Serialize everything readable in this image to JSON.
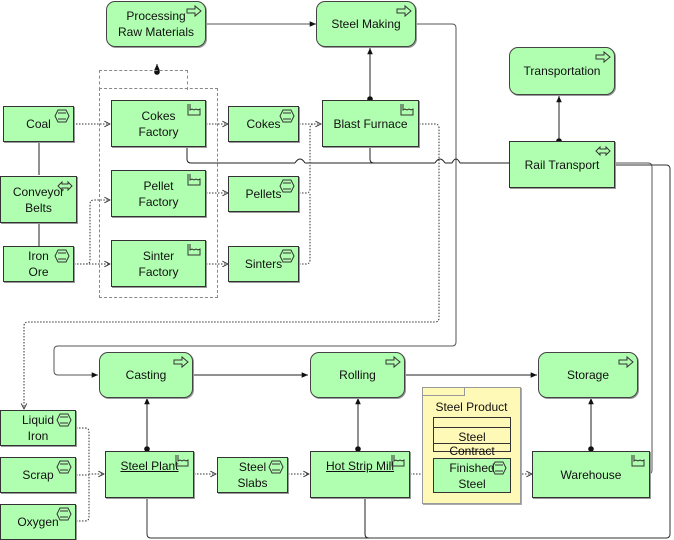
{
  "diagram": {
    "colors": {
      "element_fill": "#b0ffb0",
      "package_fill": "#fff9b8",
      "border": "#333333"
    },
    "functions": {
      "processing_raw_materials": {
        "label": "Processing\nRaw Materials",
        "icon": "function-arrow-icon"
      },
      "steel_making": {
        "label": "Steel Making",
        "icon": "function-arrow-icon"
      },
      "transportation": {
        "label": "Transportation",
        "icon": "function-arrow-icon"
      },
      "casting": {
        "label": "Casting",
        "icon": "function-arrow-icon"
      },
      "rolling": {
        "label": "Rolling",
        "icon": "function-arrow-icon"
      },
      "storage": {
        "label": "Storage",
        "icon": "function-arrow-icon"
      }
    },
    "facilities": {
      "cokes_factory": {
        "label": "Cokes\nFactory",
        "icon": "factory-icon"
      },
      "pellet_factory": {
        "label": "Pellet\nFactory",
        "icon": "factory-icon"
      },
      "sinter_factory": {
        "label": "Sinter\nFactory",
        "icon": "factory-icon"
      },
      "blast_furnace": {
        "label": "Blast Furnace",
        "icon": "factory-icon"
      },
      "steel_plant": {
        "label": "Steel Plant",
        "icon": "factory-icon"
      },
      "hot_strip_mill": {
        "label": "Hot Strip Mill",
        "icon": "factory-icon"
      },
      "warehouse": {
        "label": "Warehouse",
        "icon": "factory-icon"
      }
    },
    "materials": {
      "coal": {
        "label": "Coal",
        "icon": "material-hexagon-icon"
      },
      "iron_ore": {
        "label": "Iron\nOre",
        "icon": "material-hexagon-icon"
      },
      "cokes": {
        "label": "Cokes",
        "icon": "material-hexagon-icon"
      },
      "pellets": {
        "label": "Pellets",
        "icon": "material-hexagon-icon"
      },
      "sinters": {
        "label": "Sinters",
        "icon": "material-hexagon-icon"
      },
      "liquid_iron": {
        "label": "Liquid\nIron",
        "icon": "material-hexagon-icon"
      },
      "scrap": {
        "label": "Scrap",
        "icon": "material-hexagon-icon"
      },
      "oxygen": {
        "label": "Oxygen",
        "icon": "material-hexagon-icon"
      },
      "steel_slabs": {
        "label": "Steel\nSlabs",
        "icon": "material-hexagon-icon"
      },
      "finished_steel": {
        "label": "Finished\nSteel",
        "icon": "material-hexagon-icon"
      }
    },
    "distribution": {
      "conveyor_belts": {
        "label": "Conveyor\nBelts",
        "icon": "distribution-network-icon"
      },
      "rail_transport": {
        "label": "Rail Transport",
        "icon": "distribution-network-icon"
      }
    },
    "package": {
      "steel_product": {
        "label": "Steel Product"
      },
      "steel_contract": {
        "label": "Steel Contract"
      }
    }
  }
}
